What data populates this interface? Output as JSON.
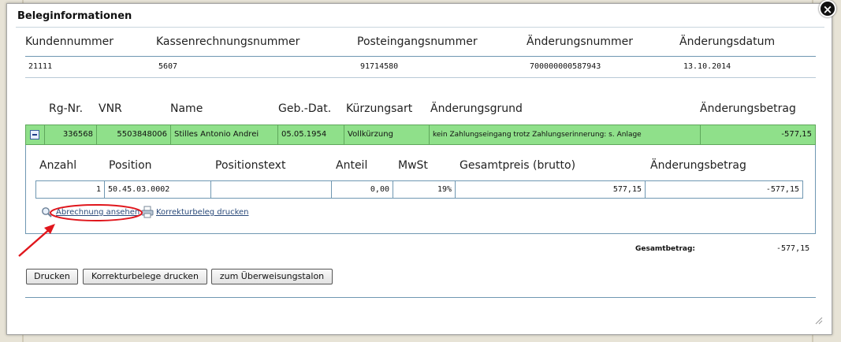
{
  "dialog": {
    "title": "Beleginformationen",
    "close_icon": "×"
  },
  "summary": {
    "headers": [
      "Kundennummer",
      "Kassenrechnungsnummer",
      "Posteingangsnummer",
      "Änderungsnummer",
      "Änderungsdatum"
    ],
    "values": [
      "21111",
      "5607",
      "91714580",
      "700000000587943",
      "13.10.2014"
    ]
  },
  "rechnung": {
    "headers": [
      "Rg-Nr.",
      "VNR",
      "Name",
      "Geb.-Dat.",
      "Kürzungsart",
      "Änderungsgrund",
      "Änderungsbetrag"
    ],
    "row": [
      "336568",
      "5503848006",
      "Stilles Antonio Andrei",
      "05.05.1954",
      "Vollkürzung",
      "kein Zahlungseingang trotz Zahlungserinnerung: s. Anlage",
      "-577,15"
    ]
  },
  "positionen": {
    "headers": [
      "Anzahl",
      "Position",
      "Positionstext",
      "Anteil",
      "MwSt",
      "Gesamtpreis (brutto)",
      "Änderungsbetrag"
    ],
    "row": [
      "1",
      "50.45.03.0002",
      "",
      "0,00",
      "19%",
      "577,15",
      "-577,15"
    ]
  },
  "links": {
    "view_invoice": "Abrechnung ansehen",
    "print_correction": "Korrekturbeleg drucken"
  },
  "total": {
    "label": "Gesamtbetrag:",
    "value": "-577,15"
  },
  "buttons": {
    "print": "Drucken",
    "print_corrections": "Korrekturbelege drucken",
    "transfer_slip": "zum Überweisungstalon"
  },
  "colors": {
    "row_highlight": "#8fe08a",
    "annotation": "#e0161c",
    "border": "#6f97b2"
  },
  "icons": {
    "close": "close-icon",
    "collapse": "minus-icon",
    "magnifier": "magnifier-icon",
    "printer": "printer-icon",
    "resize": "resize-grip-icon",
    "annotation": "red-arrow-annotation"
  }
}
